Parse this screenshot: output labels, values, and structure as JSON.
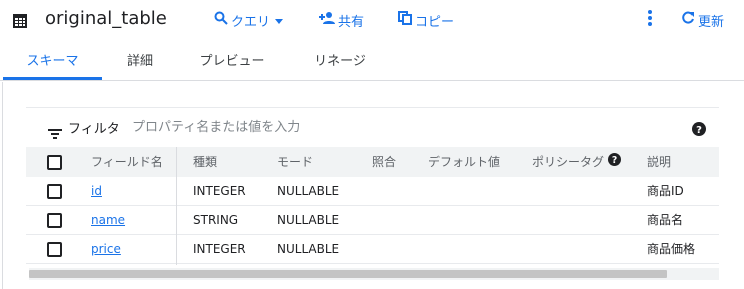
{
  "toolbar": {
    "title": "original_table",
    "query_label": "クエリ",
    "share_label": "共有",
    "copy_label": "コピー",
    "refresh_label": "更新",
    "accent_color": "#1a73e8"
  },
  "tabs": [
    {
      "label": "スキーマ",
      "active": true
    },
    {
      "label": "詳細",
      "active": false
    },
    {
      "label": "プレビュー",
      "active": false
    },
    {
      "label": "リネージ",
      "active": false
    }
  ],
  "filter": {
    "label": "フィルタ",
    "placeholder": "プロパティ名または値を入力"
  },
  "schema": {
    "headers": {
      "field_name": "フィールド名",
      "type": "種類",
      "mode": "モード",
      "collation": "照合",
      "default_value": "デフォルト値",
      "policy_tags": "ポリシータグ",
      "description": "説明"
    },
    "rows": [
      {
        "name": "id",
        "type": "INTEGER",
        "mode": "NULLABLE",
        "collation": "",
        "default_value": "",
        "policy_tags": "",
        "description": "商品ID"
      },
      {
        "name": "name",
        "type": "STRING",
        "mode": "NULLABLE",
        "collation": "",
        "default_value": "",
        "policy_tags": "",
        "description": "商品名"
      },
      {
        "name": "price",
        "type": "INTEGER",
        "mode": "NULLABLE",
        "collation": "",
        "default_value": "",
        "policy_tags": "",
        "description": "商品価格"
      }
    ]
  }
}
